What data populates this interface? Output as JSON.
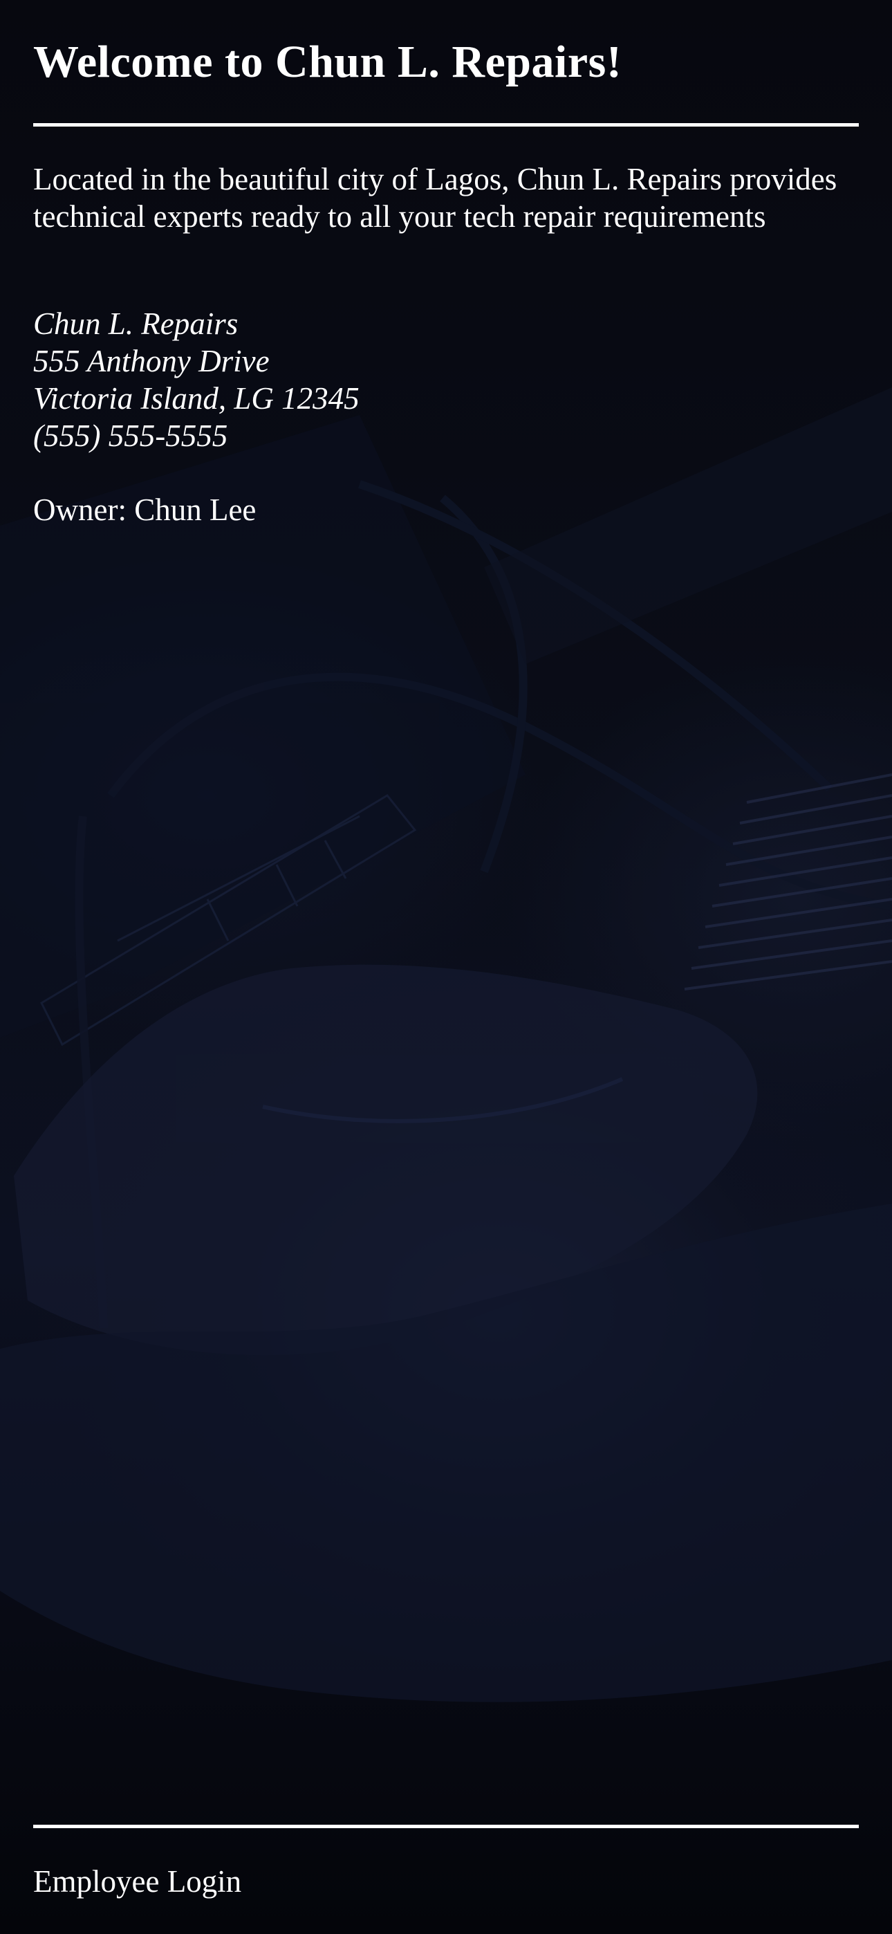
{
  "header": {
    "title": "Welcome to Chun L. Repairs!"
  },
  "main": {
    "intro": "Located in the beautiful city of Lagos, Chun L. Repairs provides technical experts ready to all your tech repair requirements",
    "address": {
      "business_name": "Chun L. Repairs",
      "street": "555 Anthony Drive",
      "city_line": "Victoria Island, LG 12345",
      "phone": "(555) 555-5555"
    },
    "owner": "Owner: Chun Lee"
  },
  "footer": {
    "login_label": "Employee Login"
  },
  "colors": {
    "text": "#ffffff",
    "background": "#05060d"
  }
}
